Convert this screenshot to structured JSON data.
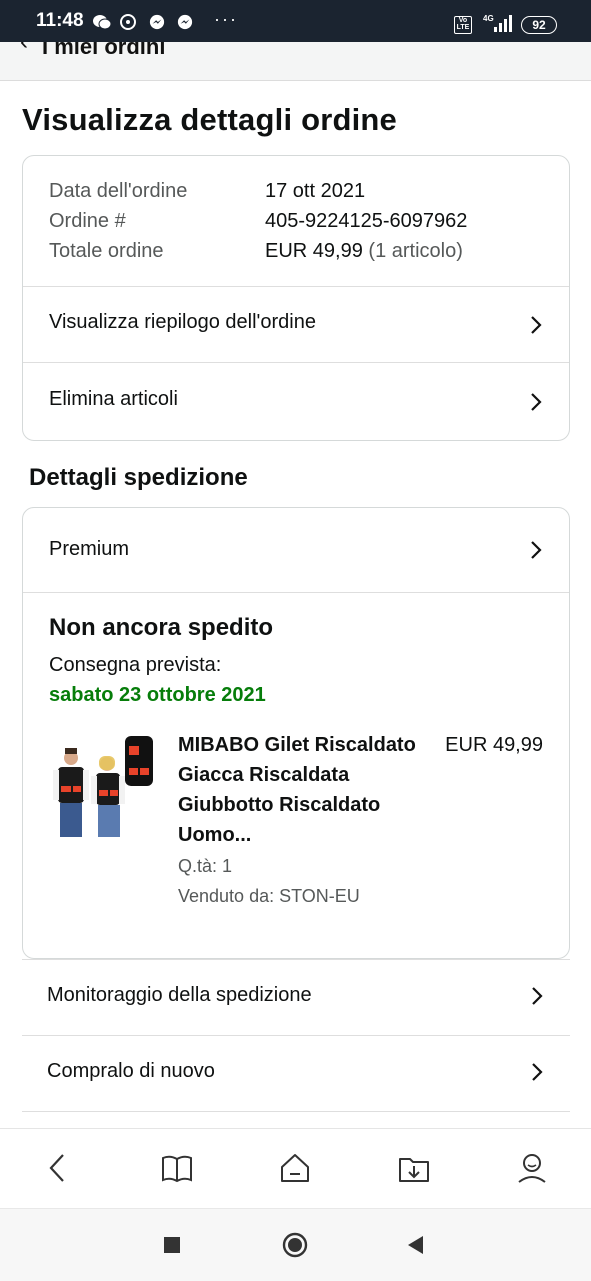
{
  "status_bar": {
    "time": "11:48",
    "battery": "92",
    "network": "4G"
  },
  "top_nav": {
    "back_label": "I miei ordini"
  },
  "page_title": "Visualizza dettagli ordine",
  "order_info": {
    "date_label": "Data dell'ordine",
    "date_value": "17 ott 2021",
    "order_label": "Ordine #",
    "order_value": "405-9224125-6097962",
    "total_label": "Totale ordine",
    "total_value": "EUR 49,99",
    "total_items": "(1 articolo)"
  },
  "order_actions": [
    {
      "label": "Visualizza riepilogo dell'ordine"
    },
    {
      "label": "Elimina articoli"
    }
  ],
  "shipping": {
    "section_title": "Dettagli spedizione",
    "method": "Premium",
    "status": "Non ancora spedito",
    "delivery_label": "Consegna prevista:",
    "delivery_date": "sabato 23 ottobre 2021",
    "product": {
      "title": "MIBABO Gilet Riscaldato Giacca Riscaldata Giubbotto Riscaldato Uomo...",
      "price": "EUR 49,99",
      "qty": "Q.tà: 1",
      "seller": "Venduto da: STON-EU"
    }
  },
  "shipment_actions": [
    {
      "label": "Monitoraggio della spedizione"
    },
    {
      "label": "Compralo di nuovo"
    }
  ],
  "bottom_nav": [
    "back-icon",
    "book-icon",
    "home-icon",
    "download-icon",
    "account-icon"
  ],
  "colors": {
    "status_bar": "#1b2430",
    "delivery_green": "#067d0a",
    "border": "#d5d9d9"
  }
}
